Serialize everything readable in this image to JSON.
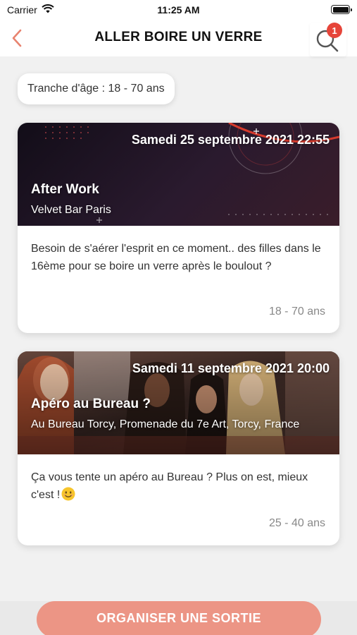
{
  "status_bar": {
    "carrier": "Carrier",
    "time": "11:25 AM"
  },
  "nav": {
    "title": "ALLER BOIRE UN VERRE",
    "search_badge": "1"
  },
  "filter": {
    "age_range_label": "Tranche d'âge : 18 - 70 ans"
  },
  "events": [
    {
      "date": "Samedi 25 septembre 2021 22:55",
      "title": "After Work",
      "place": "Velvet Bar Paris",
      "description": "Besoin de s'aérer l'esprit en ce moment.. des filles dans le 16ème pour se boire un verre après le boulout ?",
      "age_range": "18 - 70 ans"
    },
    {
      "date": "Samedi 11 septembre 2021 20:00",
      "title": "Apéro au Bureau ?",
      "place": "Au Bureau Torcy, Promenade du 7e Art, Torcy, France",
      "description": "Ça vous tente un apéro au Bureau ? Plus on est, mieux c'est !",
      "age_range": "25 - 40 ans"
    }
  ],
  "cta": {
    "label": "ORGANISER UNE SORTIE"
  },
  "colors": {
    "accent": "#ec9585",
    "badge": "#e6453a",
    "back_arrow": "#e8836f"
  },
  "icons": {
    "back": "chevron-left-icon",
    "search": "search-icon",
    "wifi": "wifi-icon",
    "battery": "battery-icon",
    "emoji": "smiley-emoji-icon"
  }
}
